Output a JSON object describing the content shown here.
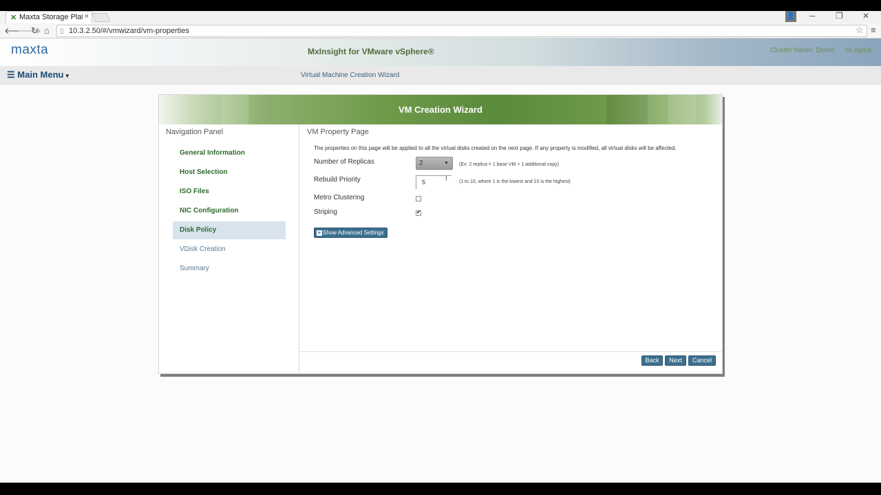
{
  "browser": {
    "tab_title": "Maxta Storage Platfo",
    "tab_favicon": "✕",
    "tab_close": "×",
    "url": "10.3.2.50/#/vmwizard/vm-properties",
    "profile_icon": "person-icon",
    "controls": {
      "minimize": "─",
      "restore": "❐",
      "close": "✕"
    }
  },
  "app": {
    "logo": "maxta",
    "title": "MxInsight for VMware vSphere®",
    "cluster_name": "Cluster Name: Demo",
    "logout": "⊖Logout",
    "main_menu": "Main Menu",
    "wizard_label": "Virtual Machine Creation Wizard"
  },
  "wizard": {
    "title": "VM Creation Wizard",
    "nav_title": "Navigation Panel",
    "nav_items": [
      {
        "label": "General Information",
        "state": "done"
      },
      {
        "label": "Host Selection",
        "state": "done"
      },
      {
        "label": "ISO Files",
        "state": "done"
      },
      {
        "label": "NIC Configuration",
        "state": "done"
      },
      {
        "label": "Disk Policy",
        "state": "active"
      },
      {
        "label": "VDisk Creation",
        "state": "todo"
      },
      {
        "label": "Summary",
        "state": "todo"
      }
    ],
    "page_title": "VM Property Page",
    "note": "The properties on this page will be applied to all the virtual disks created on the next page. If any property is modified, all virtual disks will be affected.",
    "fields": {
      "replicas": {
        "label": "Number of Replicas",
        "value": "2",
        "hint": "(Ex: 2 replica = 1 base VM + 1 additional copy)"
      },
      "rebuild": {
        "label": "Rebuild Priority",
        "value": "5",
        "hint": "(1 to 10, where 1 is the lowest and 10 is the highest)"
      },
      "metro": {
        "label": "Metro Clustering",
        "checked": false
      },
      "striping": {
        "label": "Striping",
        "checked": true
      }
    },
    "advanced_button": "Show Advanced Settings",
    "buttons": {
      "back": "Back",
      "next": "Next",
      "cancel": "Cancel"
    }
  },
  "colors": {
    "nav_done": "#2f6b2d",
    "nav_active_bg": "#d8e3ee",
    "button": "#3d6f8f",
    "header_green": "#5a8a3b"
  }
}
